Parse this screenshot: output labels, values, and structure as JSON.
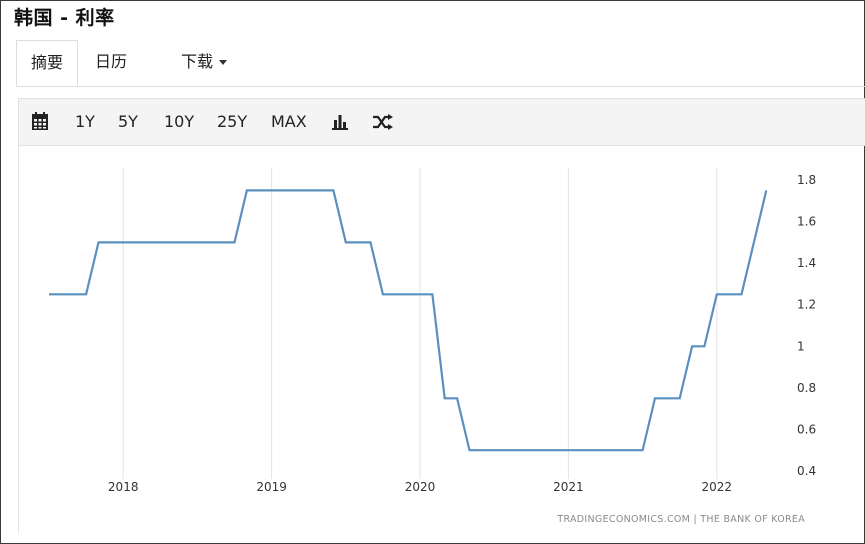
{
  "page": {
    "title": "韩国 - 利率"
  },
  "tabs": [
    {
      "label": "摘要",
      "active": true
    },
    {
      "label": "日历",
      "active": false
    },
    {
      "label": "下载",
      "active": false
    }
  ],
  "toolbar": {
    "calendar_icon": "calendar-icon",
    "ranges": [
      "1Y",
      "5Y",
      "10Y",
      "25Y",
      "MAX"
    ],
    "chart_type_icon": "bar-chart-icon",
    "compare_icon": "shuffle-icon"
  },
  "colors": {
    "line": "#5b8fc0",
    "grid": "#e3e3e3",
    "toolbar_bg": "#f4f4f4"
  },
  "chart_data": {
    "type": "line",
    "title": "",
    "xlabel": "",
    "ylabel": "",
    "x_ticks": [
      "2018",
      "2019",
      "2020",
      "2021",
      "2022"
    ],
    "y_ticks": [
      "0.4",
      "0.6",
      "0.8",
      "1",
      "1.2",
      "1.4",
      "1.6",
      "1.8"
    ],
    "ylim": [
      0.4,
      1.8
    ],
    "xlim": [
      "2017-07",
      "2022-07"
    ],
    "y_axis_side": "right",
    "grid": "vertical",
    "series": [
      {
        "points": [
          {
            "x": "2017-07",
            "y": 1.25
          },
          {
            "x": "2017-10",
            "y": 1.25
          },
          {
            "x": "2017-11",
            "y": 1.5
          },
          {
            "x": "2018-10",
            "y": 1.5
          },
          {
            "x": "2018-11",
            "y": 1.75
          },
          {
            "x": "2019-06",
            "y": 1.75
          },
          {
            "x": "2019-07",
            "y": 1.5
          },
          {
            "x": "2019-09",
            "y": 1.5
          },
          {
            "x": "2019-10",
            "y": 1.25
          },
          {
            "x": "2020-02",
            "y": 1.25
          },
          {
            "x": "2020-03",
            "y": 0.75
          },
          {
            "x": "2020-04",
            "y": 0.75
          },
          {
            "x": "2020-05",
            "y": 0.5
          },
          {
            "x": "2021-07",
            "y": 0.5
          },
          {
            "x": "2021-08",
            "y": 0.75
          },
          {
            "x": "2021-10",
            "y": 0.75
          },
          {
            "x": "2021-11",
            "y": 1.0
          },
          {
            "x": "2021-12",
            "y": 1.0
          },
          {
            "x": "2022-01",
            "y": 1.25
          },
          {
            "x": "2022-03",
            "y": 1.25
          },
          {
            "x": "2022-04",
            "y": 1.5
          },
          {
            "x": "2022-05",
            "y": 1.75
          }
        ]
      }
    ],
    "source": "TRADINGECONOMICS.COM  |  THE BANK OF KOREA"
  }
}
